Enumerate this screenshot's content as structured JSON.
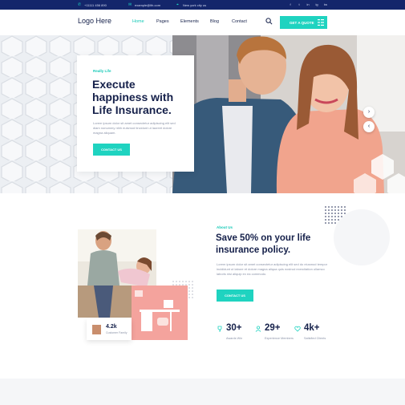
{
  "topbar": {
    "phone": "+11111 456 890",
    "email": "example@lth.com",
    "address": "New york city us",
    "social": [
      "f",
      "t",
      "in",
      "ig",
      "tw"
    ]
  },
  "header": {
    "logo": "Logo Here",
    "nav": [
      "Home",
      "Pages",
      "Elements",
      "Blog",
      "Contact"
    ],
    "active_nav": "Home",
    "cta_label": "GET A QUOTE"
  },
  "hero": {
    "eyebrow": "Really Life",
    "title": "Execute happiness with Life Insurance.",
    "description": "Lorem ipsum dolor sit amet consectetur adipiscing elit sed diam nonummy nibh euismod tincidunt ut laoreet dolore magna aliquam.",
    "button": "CONTACT US",
    "next_arrow": "›",
    "prev_arrow": "‹"
  },
  "about": {
    "eyebrow": "About Us",
    "title": "Save 50% on your life insurance policy.",
    "description": "Lorem ipsum dolor sit amet consectetur adipiscing elit sed do eiusmod tempor incididunt ut labore et dolore magna aliqua quis nostrud exercitation ullamco laboris nisi aliquip ex ea commodo.",
    "button": "CONTACT US",
    "customer_stat": {
      "value": "4.2k",
      "label": "Customer Family"
    }
  },
  "stats": [
    {
      "value": "30+",
      "label": "Awards Win"
    },
    {
      "value": "29+",
      "label": "Experience Members"
    },
    {
      "value": "4k+",
      "label": "Satisfied Clients"
    }
  ],
  "colors": {
    "accent": "#1fd3c0",
    "navy": "#14266b",
    "text": "#15204a"
  }
}
